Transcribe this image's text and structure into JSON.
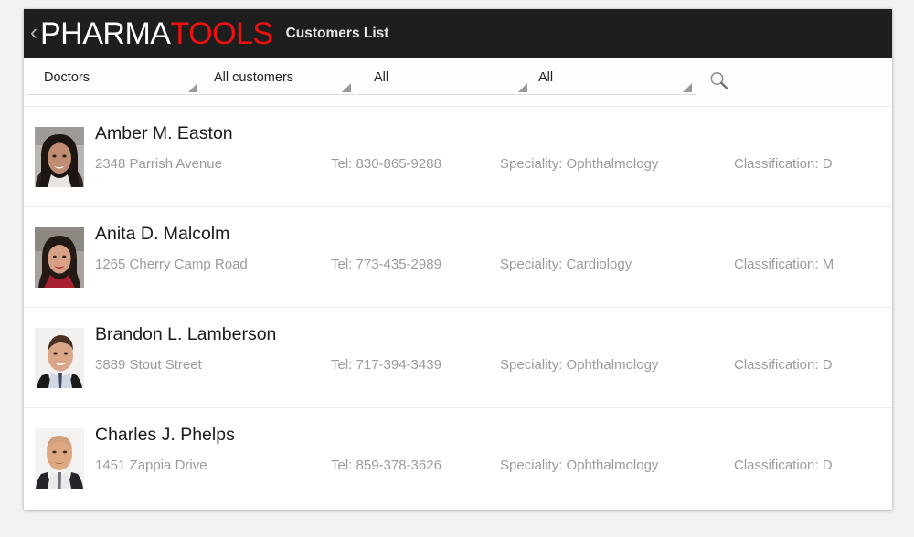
{
  "header": {
    "back_icon": "back-chevron-icon",
    "brand_first": "PHARMA",
    "brand_second": "TOOLS",
    "page_title": "Customers List",
    "brand_color_primary": "#ffffff",
    "brand_color_accent": "#ee1111",
    "background": "#1e1e1e"
  },
  "filters": [
    {
      "name": "customer-type",
      "value": "Doctors"
    },
    {
      "name": "customer-scope",
      "value": "All customers"
    },
    {
      "name": "speciality",
      "value": "All"
    },
    {
      "name": "classification",
      "value": "All"
    }
  ],
  "search": {
    "icon": "search-icon",
    "label": "Search"
  },
  "list": {
    "labels": {
      "tel_prefix": "Tel: ",
      "speciality_prefix": "Speciality: ",
      "classification_prefix": "Classification: "
    },
    "rows": [
      {
        "name": "Amber M. Easton",
        "address": "2348 Parrish Avenue",
        "tel": "Tel: 830-865-9288",
        "speciality": "Speciality: Ophthalmology",
        "classification": "Classification: D",
        "avatar": "photo-female-dark-hair"
      },
      {
        "name": "Anita D. Malcolm",
        "address": "1265 Cherry Camp Road",
        "tel": "Tel: 773-435-2989",
        "speciality": "Speciality: Cardiology",
        "classification": "Classification: M",
        "avatar": "photo-female-red-top"
      },
      {
        "name": "Brandon L. Lamberson",
        "address": "3889 Stout Street",
        "tel": "Tel: 717-394-3439",
        "speciality": "Speciality: Ophthalmology",
        "classification": "Classification: D",
        "avatar": "photo-male-dark-suit"
      },
      {
        "name": "Charles J. Phelps",
        "address": "1451 Zappia Drive",
        "tel": "Tel: 859-378-3626",
        "speciality": "Speciality: Ophthalmology",
        "classification": "Classification: D",
        "avatar": "photo-male-bald-suit"
      }
    ]
  }
}
